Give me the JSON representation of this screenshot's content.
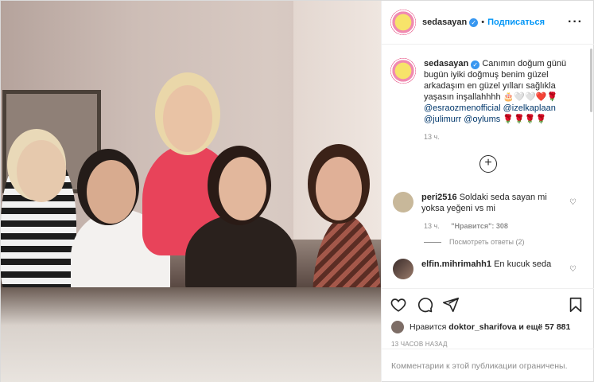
{
  "post": {
    "username": "sedasayan",
    "follow_label": "Подписаться",
    "more_label": "···"
  },
  "caption": {
    "username": "sedasayan",
    "text": "Canımın doğum günü bugün iyiki doğmuş benim güzel arkadaşım en güzel yılları sağlıkla yaşasın inşallahhhh 🎂🤍🤍❤️🌹",
    "mentions": "@esraozmenofficial @izelkaplaan @julimurr @oylums",
    "mentions_suffix": "🌹🌹🌹🌹",
    "time": "13 ч."
  },
  "load_more_label": "+",
  "comments": [
    {
      "username": "peri2516",
      "text": "Soldaki seda sayan mi yoksa yeğeni vs mi",
      "time": "13 ч.",
      "likes": "\"Нравится\": 308",
      "replies": "Посмотреть ответы (2)"
    },
    {
      "username": "elfin.mihrimahh1",
      "text": "En kucuk seda"
    }
  ],
  "likes": {
    "prefix": "Нравится",
    "user": "doktor_sharifova",
    "suffix": "и ещё 57 881"
  },
  "posted_ago": "13 часов назад",
  "comments_limited": "Комментарии к этой публикации ограничены.",
  "colors": {
    "accent": "#0095f6",
    "verified": "#3897f0",
    "muted": "#8e8e8e",
    "mention": "#00376b"
  },
  "icons": [
    "heart-icon",
    "comment-icon",
    "share-icon",
    "save-icon",
    "more-icon",
    "verified-icon",
    "add-comment-icon"
  ]
}
